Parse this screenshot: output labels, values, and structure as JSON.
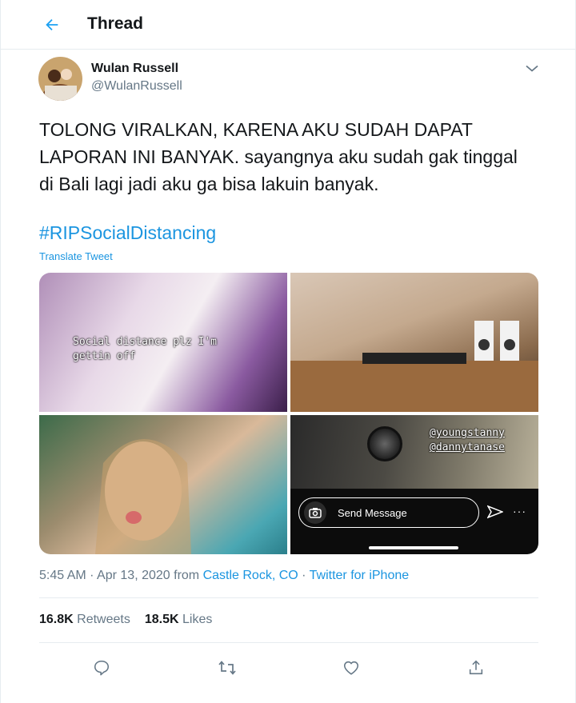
{
  "header": {
    "title": "Thread",
    "back_icon": "arrow-left-icon",
    "accent": "#1da1f2"
  },
  "author": {
    "name": "Wulan Russell",
    "handle": "@WulanRussell",
    "menu_icon": "chevron-down-icon"
  },
  "tweet": {
    "text": "TOLONG VIRALKAN, KARENA AKU SUDAH DAPAT LAPORAN INI BANYAK. sayangnya aku sudah gak tinggal di Bali lagi jadi aku ga bisa lakuin banyak.",
    "hashtag": "#RIPSocialDistancing",
    "translate_label": "Translate Tweet"
  },
  "media": {
    "overlay_1": "Social distance plz I'm\ngettin off",
    "overlay_4_mentions": "@youngstanny\n@dannytanase",
    "message_placeholder": "Send Message",
    "more_label": "···"
  },
  "meta": {
    "time": "5:45 AM",
    "sep1": " · ",
    "date": "Apr 13, 2020",
    "from": " from ",
    "location": "Castle Rock, CO",
    "sep2": " · ",
    "source": "Twitter for iPhone"
  },
  "stats": {
    "retweets_count": "16.8K",
    "retweets_label": " Retweets",
    "likes_count": "18.5K",
    "likes_label": " Likes"
  },
  "actions": [
    "reply-icon",
    "retweet-icon",
    "like-icon",
    "share-icon"
  ],
  "colors": {
    "link": "#1b95e0",
    "muted": "#657786",
    "text": "#14171a",
    "border": "#e6ecf0"
  }
}
